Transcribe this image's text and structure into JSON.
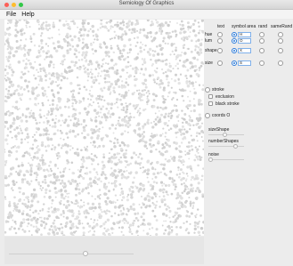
{
  "window": {
    "title": "Semiology Of Graphics"
  },
  "menu": {
    "file": "File",
    "help": "Help"
  },
  "panel": {
    "headers": {
      "text": "text",
      "symbol_area": "symbol area",
      "rand": "rand",
      "sameRand": "sameRand"
    },
    "rows": [
      {
        "label": "hue",
        "symbol_value": "H"
      },
      {
        "label": "lum",
        "symbol_value": "O"
      },
      {
        "label": "shape",
        "symbol_value": "X"
      },
      {
        "label": "size",
        "symbol_value": "S"
      }
    ],
    "stroke": {
      "label": "stroke",
      "exclusion": "exclusion",
      "black_stroke": "black stroke"
    },
    "coords": {
      "label": "coords O"
    },
    "sliders": [
      {
        "label": "sizeShape",
        "value": 0.45
      },
      {
        "label": "numberShapes",
        "value": 0.8
      },
      {
        "label": "noise",
        "value": 0.0
      }
    ]
  },
  "bottom": {
    "slider_value": 0.62
  }
}
